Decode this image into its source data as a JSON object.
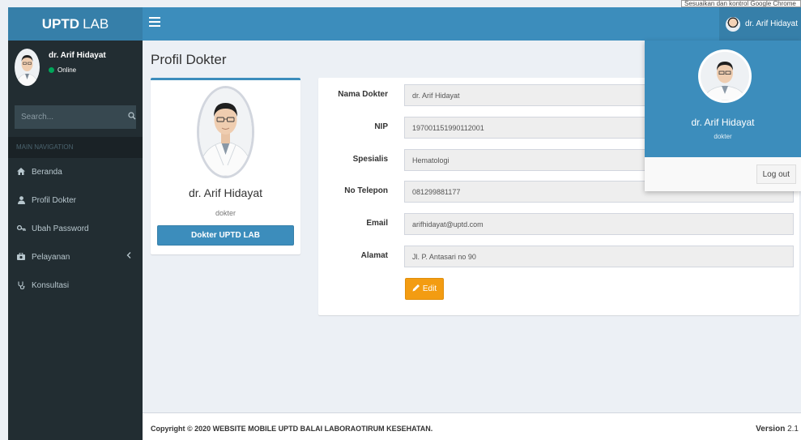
{
  "tooltip": "Sesuaikan dan kontrol Google Chrome",
  "brand": {
    "bold": "UPTD",
    "rest": "LAB"
  },
  "navbar": {
    "user_name": "dr. Arif Hidayat"
  },
  "sidebar": {
    "user_name": "dr. Arif Hidayat",
    "status": "Online",
    "search_placeholder": "Search...",
    "header": "MAIN NAVIGATION",
    "items": [
      {
        "label": "Beranda",
        "icon": "home-icon"
      },
      {
        "label": "Profil Dokter",
        "icon": "user-icon"
      },
      {
        "label": "Ubah Password",
        "icon": "key-icon"
      },
      {
        "label": "Pelayanan",
        "icon": "briefcase-icon"
      },
      {
        "label": "Konsultasi",
        "icon": "stethoscope-icon"
      }
    ]
  },
  "page": {
    "title": "Profil Dokter"
  },
  "profile": {
    "name": "dr. Arif Hidayat",
    "role": "dokter",
    "button": "Dokter UPTD LAB"
  },
  "form": {
    "fields": [
      {
        "label": "Nama Dokter",
        "value": "dr. Arif Hidayat"
      },
      {
        "label": "NIP",
        "value": "197001151990112001"
      },
      {
        "label": "Spesialis",
        "value": "Hematologi"
      },
      {
        "label": "No Telepon",
        "value": "081299881177"
      },
      {
        "label": "Email",
        "value": "arifhidayat@uptd.com"
      },
      {
        "label": "Alamat",
        "value": "Jl. P. Antasari no 90"
      }
    ],
    "edit_label": "Edit"
  },
  "dropdown": {
    "name": "dr. Arif Hidayat",
    "role": "dokter",
    "logout": "Log out"
  },
  "footer": {
    "copyright": "Copyright © 2020 WEBSITE MOBILE UPTD BALAI LABORAOTIRUM KESEHATAN.",
    "version_label": "Version",
    "version_number": "2.1"
  },
  "colors": {
    "primary": "#3c8dbc",
    "sidebar": "#222d32",
    "warning": "#f39c12",
    "online": "#00a65a"
  }
}
